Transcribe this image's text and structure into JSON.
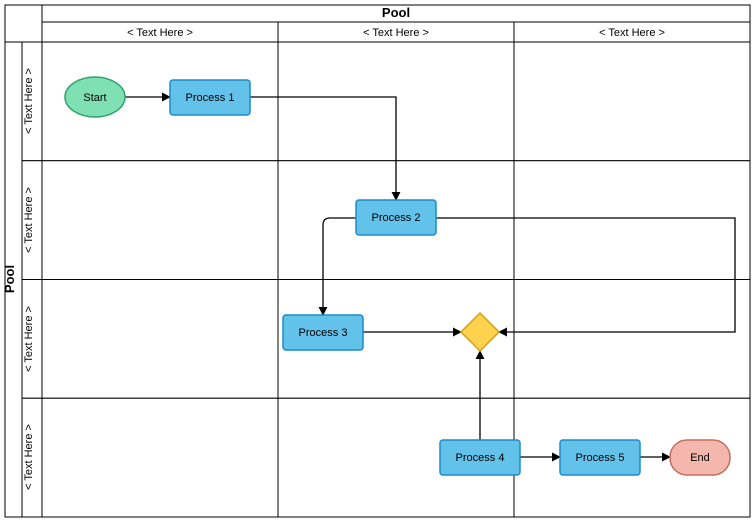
{
  "pool_top": {
    "title": "Pool"
  },
  "pool_left": {
    "title": "Pool"
  },
  "columns": [
    {
      "label": "< Text Here >"
    },
    {
      "label": "< Text Here >"
    },
    {
      "label": "< Text Here >"
    }
  ],
  "rows": [
    {
      "label": "< Text Here >"
    },
    {
      "label": "< Text Here >"
    },
    {
      "label": "< Text Here >"
    },
    {
      "label": "< Text Here >"
    }
  ],
  "nodes": {
    "start": {
      "label": "Start"
    },
    "process1": {
      "label": "Process 1"
    },
    "process2": {
      "label": "Process 2"
    },
    "process3": {
      "label": "Process 3"
    },
    "process4": {
      "label": "Process 4"
    },
    "process5": {
      "label": "Process 5"
    },
    "end": {
      "label": "End"
    }
  },
  "colors": {
    "process_fill": "#63c2ea",
    "process_stroke": "#1b8cc7",
    "start_fill": "#7fe0b3",
    "start_stroke": "#2fa36e",
    "end_fill": "#f4b7ad",
    "end_stroke": "#c46d5e",
    "decision_fill": "#ffd24d",
    "decision_stroke": "#d4a017",
    "line": "#000000"
  }
}
